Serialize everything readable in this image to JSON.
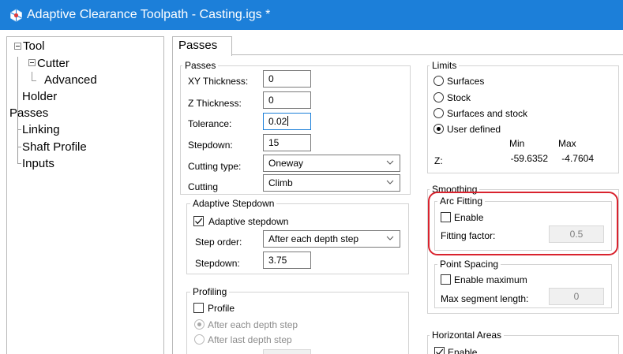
{
  "window": {
    "title": "Adaptive Clearance Toolpath - Casting.igs *",
    "accent_color": "#1c7fd9",
    "icon": "app-logo-icon"
  },
  "tree": {
    "items": [
      {
        "label": "Tool"
      },
      {
        "label": "Cutter"
      },
      {
        "label": "Advanced"
      },
      {
        "label": "Holder"
      },
      {
        "label": "Passes"
      },
      {
        "label": "Linking"
      },
      {
        "label": "Shaft Profile"
      },
      {
        "label": "Inputs"
      }
    ]
  },
  "tab": {
    "label": "Passes"
  },
  "passes": {
    "title": "Passes",
    "xy_thickness": {
      "label": "XY Thickness:",
      "value": "0"
    },
    "z_thickness": {
      "label": "Z Thickness:",
      "value": "0"
    },
    "tolerance": {
      "label": "Tolerance:",
      "value": "0.02"
    },
    "stepdown": {
      "label": "Stepdown:",
      "value": "15"
    },
    "cutting_type": {
      "label": "Cutting type:",
      "value": "Oneway"
    },
    "cutting": {
      "label": "Cutting",
      "value": "Climb"
    }
  },
  "adaptive_stepdown": {
    "title": "Adaptive Stepdown",
    "checkbox_label": "Adaptive stepdown",
    "checked": true,
    "step_order": {
      "label": "Step order:",
      "value": "After each depth step"
    },
    "stepdown": {
      "label": "Stepdown:",
      "value": "3.75"
    }
  },
  "profiling": {
    "title": "Profiling",
    "checkbox_label": "Profile",
    "checked": false,
    "options": [
      {
        "label": "After each depth step",
        "selected": true
      },
      {
        "label": "After last depth step",
        "selected": false
      }
    ]
  },
  "limits": {
    "title": "Limits",
    "options": [
      {
        "label": "Surfaces",
        "selected": false
      },
      {
        "label": "Stock",
        "selected": false
      },
      {
        "label": "Surfaces and stock",
        "selected": false
      },
      {
        "label": "User defined",
        "selected": true
      }
    ],
    "min_header": "Min",
    "max_header": "Max",
    "z_label": "Z:",
    "z_min": "-59.6352",
    "z_max": "-4.7604"
  },
  "smoothing": {
    "title": "Smoothing",
    "arc_fitting": {
      "title": "Arc Fitting",
      "enable_label": "Enable",
      "enabled": false,
      "factor_label": "Fitting factor:",
      "factor_value": "0.5"
    },
    "point_spacing": {
      "title": "Point Spacing",
      "enable_label": "Enable maximum",
      "enabled": false,
      "max_label": "Max segment length:",
      "max_value": "0"
    },
    "highlight_color": "#d9232e"
  },
  "horizontal_areas": {
    "title": "Horizontal Areas",
    "enable_label": "Enable",
    "enabled": true
  }
}
